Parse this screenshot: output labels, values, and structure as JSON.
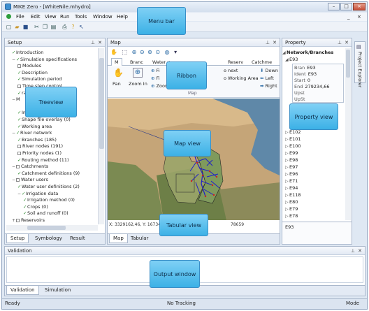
{
  "window": {
    "title": "MIKE Zero - [WhiteNile.mhydro]",
    "buttons": [
      "–",
      "□",
      "×"
    ]
  },
  "menubar": {
    "items": [
      "File",
      "Edit",
      "View",
      "Run",
      "Tools",
      "Window",
      "Help"
    ],
    "right_buttons": [
      "_",
      "×"
    ]
  },
  "toolbar": {
    "icons": [
      "new-icon",
      "open-icon",
      "save-icon",
      "cut-icon",
      "copy-icon",
      "paste-icon",
      "print-icon",
      "help-icon",
      "whats-this-icon"
    ]
  },
  "setup": {
    "title": "Setup",
    "tree": [
      {
        "label": "Introduction",
        "state": "check",
        "indent": 1
      },
      {
        "label": "Simulation specifications",
        "state": "check",
        "indent": 1,
        "expander": "−"
      },
      {
        "label": "Modules",
        "state": "box",
        "indent": 2
      },
      {
        "label": "Description",
        "state": "check",
        "indent": 2
      },
      {
        "label": "Simulation period",
        "state": "check",
        "indent": 2
      },
      {
        "label": "Time step control",
        "state": "box",
        "indent": 2
      },
      {
        "label": "rameter",
        "state": "check",
        "indent": 2
      },
      {
        "label": "M",
        "state": "none",
        "indent": 1,
        "expander": "−"
      },
      {
        "label": "",
        "state": "none",
        "indent": 2
      },
      {
        "label": "Image overlay (0)",
        "state": "check",
        "indent": 2
      },
      {
        "label": "Shape file overlay (0)",
        "state": "check",
        "indent": 2
      },
      {
        "label": "Working area",
        "state": "check",
        "indent": 2
      },
      {
        "label": "River network",
        "state": "check",
        "indent": 1,
        "expander": "−"
      },
      {
        "label": "Branches (185)",
        "state": "check",
        "indent": 2
      },
      {
        "label": "River nodes (191)",
        "state": "box",
        "indent": 2
      },
      {
        "label": "Priority nodes (1)",
        "state": "box",
        "indent": 2
      },
      {
        "label": "Routing method (11)",
        "state": "check",
        "indent": 2
      },
      {
        "label": "Catchments",
        "state": "box",
        "indent": 1,
        "expander": "−"
      },
      {
        "label": "Catchment definitions (9)",
        "state": "check",
        "indent": 2
      },
      {
        "label": "Water users",
        "state": "box",
        "indent": 1,
        "expander": "−"
      },
      {
        "label": "Water user definitions (2)",
        "state": "check",
        "indent": 2
      },
      {
        "label": "Irrigation data",
        "state": "check",
        "indent": 2,
        "expander": "−"
      },
      {
        "label": "Irrigation method (0)",
        "state": "check",
        "indent": 3
      },
      {
        "label": "Crops (0)",
        "state": "check",
        "indent": 3
      },
      {
        "label": "Soil and runoff (0)",
        "state": "check",
        "indent": 3
      },
      {
        "label": "Reservoirs",
        "state": "box",
        "indent": 1,
        "expander": "+"
      }
    ],
    "tabs": [
      "Setup",
      "Symbology",
      "Result"
    ]
  },
  "map": {
    "title": "Map",
    "ribbon_tabs": [
      "M",
      "Branc",
      "Water u",
      "Reserv",
      "Catchme"
    ],
    "buttons": {
      "pan": "Pan",
      "zoom_in": "Zoom In",
      "fit_1": "Fi",
      "fit_2": "Fi",
      "zoom_region": "Zoom r",
      "to_next": "o next",
      "to_working_area": "o Working Area",
      "down": "Down",
      "left": "Left",
      "right": "Right"
    },
    "group_label": "Map",
    "coords_left": "X: 3329162,46, Y: 1673492",
    "coords_right": "78659",
    "tabs": [
      "Map",
      "Tabular"
    ]
  },
  "property": {
    "title": "Property",
    "header_group": "Network/Branches",
    "selected": "E93",
    "fields": [
      {
        "label": "Bran",
        "value": "E93"
      },
      {
        "label": "Ident",
        "value": "E93"
      },
      {
        "label": "Start",
        "value": "0"
      },
      {
        "label": "End",
        "value": "279234,66"
      },
      {
        "label": "Upst",
        "value": ""
      },
      {
        "label": "UpSt",
        "value": ""
      }
    ],
    "items": [
      "E102",
      "E101",
      "E100",
      "E99",
      "E98",
      "E97",
      "E96",
      "E71",
      "E94",
      "E118",
      "E80",
      "E79",
      "E78"
    ],
    "footer": "E93"
  },
  "explorer": {
    "label": "Project Explorer"
  },
  "validation": {
    "title": "Validation",
    "tabs": [
      "Validation",
      "Simulation"
    ]
  },
  "statusbar": {
    "left": "Ready",
    "center": "No Tracking",
    "right": "Mode"
  },
  "callouts": {
    "menu_bar": "Menu bar",
    "ribbon": "Ribbon",
    "treeview": "Treeview",
    "map_view": "Map view",
    "property_view": "Property view",
    "tabular_view": "Tabular view",
    "output_window": "Output window"
  },
  "colors": {
    "callout_fill": "#3cb1e6",
    "accent_check": "#2e8b2e",
    "frame": "#dfe8f3",
    "network_lines": "#2020c8"
  }
}
